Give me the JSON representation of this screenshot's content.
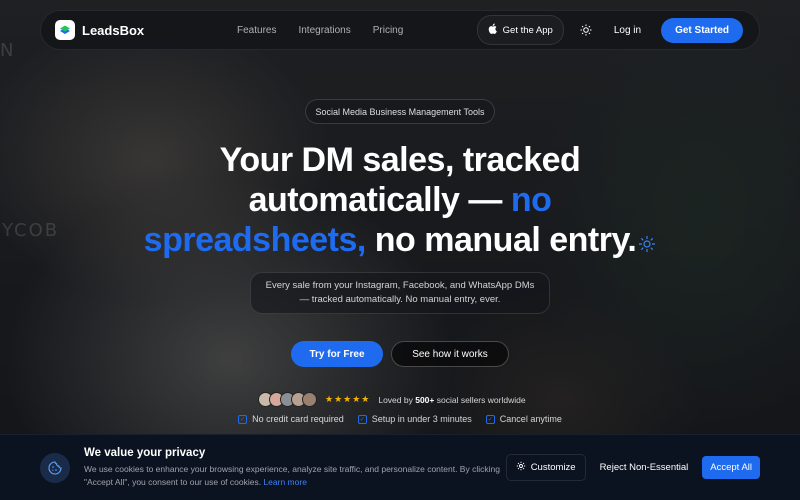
{
  "nav": {
    "brand": "LeadsBox",
    "links": [
      "Features",
      "Integrations",
      "Pricing"
    ],
    "app_label": "Get the App",
    "login_label": "Log in",
    "cta_label": "Get Started"
  },
  "hero": {
    "pill": "Social Media Business Management Tools",
    "headline_line1": "Your DM sales, tracked",
    "headline_line2_white": "automatically — ",
    "headline_line2_blue": "no",
    "headline_line3_blue": "spreadsheets,",
    "headline_line3_white": " no manual entry.",
    "subtext": "Every sale from your Instagram, Facebook, and WhatsApp DMs — tracked automatically. No manual entry, ever.",
    "try_label": "Try for Free",
    "how_label": "See how it works",
    "stars": "★★★★★",
    "loved_prefix": "Loved by ",
    "loved_count": "500+",
    "loved_suffix": " social sellers worldwide",
    "checks": [
      "No credit card required",
      "Setup in under 3 minutes",
      "Cancel anytime"
    ],
    "avatar_colors": [
      "#c9b9a8",
      "#d4a89a",
      "#8a8f96",
      "#b8a090",
      "#9a8070"
    ]
  },
  "background_text": [
    "YCOB",
    "N"
  ],
  "cookie": {
    "title": "We value your privacy",
    "body": "We use cookies to enhance your browsing experience, analyze site traffic, and personalize content. By clicking \"Accept All\", you consent to our use of cookies. ",
    "link": "Learn more",
    "customize_label": "Customize",
    "reject_label": "Reject Non-Essential",
    "accept_label": "Accept All"
  },
  "colors": {
    "accent": "#1e6bf0",
    "star": "#f5b301",
    "banner_bg": "#0b1220"
  },
  "icons": [
    "leadsbox-logo-icon",
    "apple-icon",
    "sun-icon",
    "sparkle-icon",
    "cookie-icon",
    "gear-icon",
    "check-icon"
  ]
}
